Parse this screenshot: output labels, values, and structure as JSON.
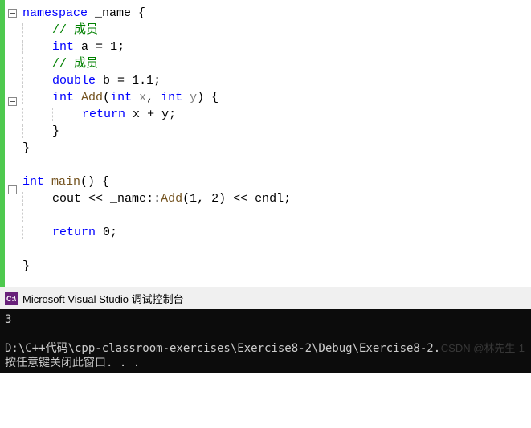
{
  "code": {
    "lines": [
      {
        "indent": 0,
        "fold": true,
        "tokens": [
          {
            "t": "namespace ",
            "c": "kw"
          },
          {
            "t": "_name ",
            "c": "ident"
          },
          {
            "t": "{",
            "c": "punct"
          }
        ]
      },
      {
        "indent": 1,
        "tokens": [
          {
            "t": "// 成员",
            "c": "comment"
          }
        ]
      },
      {
        "indent": 1,
        "tokens": [
          {
            "t": "int ",
            "c": "type"
          },
          {
            "t": "a ",
            "c": "ident"
          },
          {
            "t": "= ",
            "c": "punct"
          },
          {
            "t": "1",
            "c": "num"
          },
          {
            "t": ";",
            "c": "punct"
          }
        ]
      },
      {
        "indent": 1,
        "tokens": [
          {
            "t": "// 成员",
            "c": "comment"
          }
        ]
      },
      {
        "indent": 1,
        "tokens": [
          {
            "t": "double ",
            "c": "type"
          },
          {
            "t": "b ",
            "c": "ident"
          },
          {
            "t": "= ",
            "c": "punct"
          },
          {
            "t": "1.1",
            "c": "num"
          },
          {
            "t": ";",
            "c": "punct"
          }
        ]
      },
      {
        "indent": 1,
        "fold": true,
        "tokens": [
          {
            "t": "int ",
            "c": "type"
          },
          {
            "t": "Add",
            "c": "func"
          },
          {
            "t": "(",
            "c": "punct"
          },
          {
            "t": "int ",
            "c": "type"
          },
          {
            "t": "x",
            "c": "param"
          },
          {
            "t": ", ",
            "c": "punct"
          },
          {
            "t": "int ",
            "c": "type"
          },
          {
            "t": "y",
            "c": "param"
          },
          {
            "t": ") {",
            "c": "punct"
          }
        ]
      },
      {
        "indent": 2,
        "tokens": [
          {
            "t": "return ",
            "c": "kw"
          },
          {
            "t": "x ",
            "c": "ident"
          },
          {
            "t": "+ ",
            "c": "punct"
          },
          {
            "t": "y",
            "c": "ident"
          },
          {
            "t": ";",
            "c": "punct"
          }
        ]
      },
      {
        "indent": 1,
        "tokens": [
          {
            "t": "}",
            "c": "punct"
          }
        ]
      },
      {
        "indent": 0,
        "tokens": [
          {
            "t": "}",
            "c": "punct"
          }
        ]
      },
      {
        "indent": 0,
        "tokens": []
      },
      {
        "indent": 0,
        "fold": true,
        "tokens": [
          {
            "t": "int ",
            "c": "type"
          },
          {
            "t": "main",
            "c": "func"
          },
          {
            "t": "() {",
            "c": "punct"
          }
        ]
      },
      {
        "indent": 1,
        "tokens": [
          {
            "t": "cout ",
            "c": "ident"
          },
          {
            "t": "<< ",
            "c": "punct"
          },
          {
            "t": "_name",
            "c": "ident"
          },
          {
            "t": "::",
            "c": "punct"
          },
          {
            "t": "Add",
            "c": "func"
          },
          {
            "t": "(",
            "c": "punct"
          },
          {
            "t": "1",
            "c": "num"
          },
          {
            "t": ", ",
            "c": "punct"
          },
          {
            "t": "2",
            "c": "num"
          },
          {
            "t": ") << ",
            "c": "punct"
          },
          {
            "t": "endl",
            "c": "ident"
          },
          {
            "t": ";",
            "c": "punct"
          }
        ]
      },
      {
        "indent": 1,
        "tokens": []
      },
      {
        "indent": 1,
        "tokens": [
          {
            "t": "return ",
            "c": "kw"
          },
          {
            "t": "0",
            "c": "num"
          },
          {
            "t": ";",
            "c": "punct"
          }
        ]
      },
      {
        "indent": 0,
        "tokens": []
      },
      {
        "indent": 0,
        "tokens": [
          {
            "t": "}",
            "c": "punct"
          }
        ]
      }
    ]
  },
  "console": {
    "icon": "C:\\",
    "title": "Microsoft Visual Studio 调试控制台",
    "output_line1": "3",
    "output_line2": "",
    "output_line3": "D:\\C++代码\\cpp-classroom-exercises\\Exercise8-2\\Debug\\Exercise8-2.",
    "output_line4": "按任意键关闭此窗口. . ."
  },
  "watermark": "CSDN @林先生-1"
}
